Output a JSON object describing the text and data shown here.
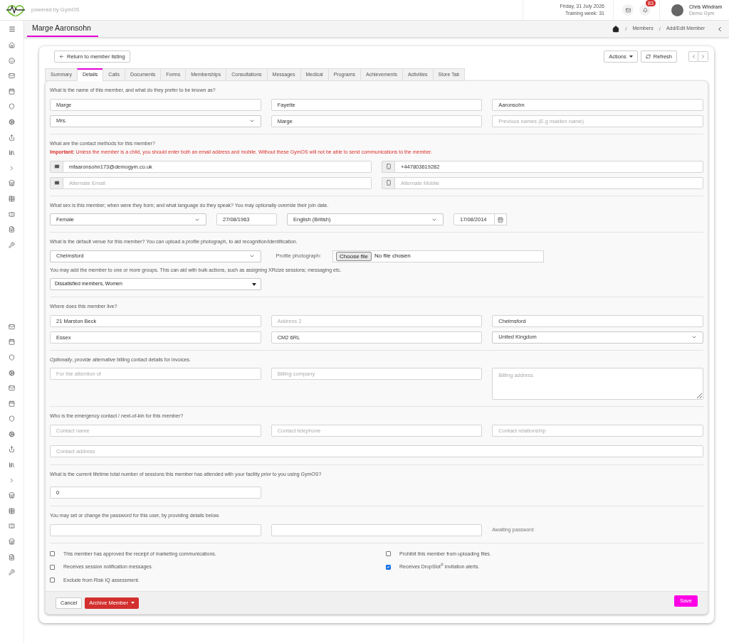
{
  "header": {
    "powered_by": "powered by GymOS",
    "date": "Friday, 31 July 2026",
    "training_week": "Training week: 31",
    "notification_count": "83",
    "user_name": "Chris Windram",
    "user_gym": "Demo Gym"
  },
  "page_title": "Marge Aaronsohn",
  "breadcrumb": [
    {
      "separator": "/",
      "label": "Members"
    },
    {
      "separator": "/",
      "label": "Add/Edit Member"
    }
  ],
  "back_button": "Return to member listing",
  "actions_button": "Actions",
  "refresh_button": "Refresh",
  "tabs": [
    {
      "label": "Summary",
      "selected": false
    },
    {
      "label": "Details",
      "selected": true
    },
    {
      "label": "Calls",
      "selected": false
    },
    {
      "label": "Documents",
      "selected": false
    },
    {
      "label": "Forms",
      "selected": false
    },
    {
      "label": "Memberships",
      "selected": false
    },
    {
      "label": "Consultations",
      "selected": false
    },
    {
      "label": "Messages",
      "selected": false
    },
    {
      "label": "Medical",
      "selected": false
    },
    {
      "label": "Programs",
      "selected": false
    },
    {
      "label": "Achievements",
      "selected": false
    },
    {
      "label": "Activities",
      "selected": false
    },
    {
      "label": "Store Tab",
      "selected": false
    }
  ],
  "sections": [
    {
      "blocks": [
        {
          "kind": "question",
          "text": "What is the name of this member, and what do they prefer to be known as?"
        },
        {
          "kind": "row",
          "fields": [
            {
              "kind": "text",
              "value": "Marge"
            },
            {
              "kind": "text",
              "value": "Fayette"
            },
            {
              "kind": "text",
              "value": "Aaronsohn"
            }
          ]
        },
        {
          "kind": "row",
          "fields": [
            {
              "kind": "select",
              "value": "Mrs."
            },
            {
              "kind": "text",
              "value": "Marge"
            },
            {
              "kind": "text",
              "placeholder": "Previous names (E.g maiden name)"
            }
          ]
        }
      ]
    },
    {
      "blocks": [
        {
          "kind": "question",
          "text": "What are the contact methods for this member?"
        },
        {
          "kind": "warning",
          "text": "**Important:** Unless the member is a child, you should enter both an email address and mobile. Without these GymOS will not be able to send communications to the member."
        },
        {
          "kind": "row",
          "fields": [
            {
              "kind": "email",
              "value": "mfaaronsohn173@demogym.co.uk"
            },
            {
              "kind": "phone",
              "value": "+447803619282"
            }
          ]
        },
        {
          "kind": "row",
          "fields": [
            {
              "kind": "email",
              "placeholder": "Alternate Email"
            },
            {
              "kind": "phone",
              "placeholder": "Alternate Mobile"
            }
          ]
        }
      ]
    },
    {
      "blocks": [
        {
          "kind": "question",
          "text": "What sex is this member; when were they born; and what language do they speak? You may optionally override their join date."
        },
        {
          "kind": "row",
          "fields": [
            {
              "kind": "select",
              "value": "Female"
            },
            {
              "kind": "text",
              "value": "27/08/1963"
            },
            {
              "kind": "select",
              "value": "English (British)"
            },
            {
              "kind": "date",
              "value": "17/08/2014"
            }
          ]
        }
      ]
    },
    {
      "blocks": [
        {
          "kind": "question",
          "text": "What is the default venue for this member? You can upload a profile photograph, to aid recognition/identification."
        },
        {
          "kind": "row",
          "fields": [
            {
              "kind": "select",
              "value": "Chelmsford"
            },
            {
              "kind": "file",
              "label": "Profile photograph:",
              "button": "Choose file",
              "status": "No file chosen"
            }
          ]
        },
        {
          "kind": "question",
          "text": "You may add the member to one or more groups. This can aid with bulk actions, such as assigning XRcize sessions; messaging etc."
        },
        {
          "kind": "row",
          "fields": [
            {
              "kind": "multiselect",
              "value": "Dissatisfied members, Women"
            }
          ]
        }
      ]
    },
    {
      "blocks": [
        {
          "kind": "question",
          "text": "Where does this member live?"
        },
        {
          "kind": "row",
          "fields": [
            {
              "kind": "text",
              "value": "21 Marston Beck"
            },
            {
              "kind": "text",
              "placeholder": "Address 2"
            },
            {
              "kind": "text",
              "value": "Chelmsford"
            }
          ]
        },
        {
          "kind": "row",
          "fields": [
            {
              "kind": "text",
              "value": "Essex"
            },
            {
              "kind": "text",
              "value": "CM2 6RL"
            },
            {
              "kind": "select",
              "value": "United Kingdom"
            }
          ]
        }
      ]
    },
    {
      "blocks": [
        {
          "kind": "question",
          "text": "*Optionally*, provide alternative billing contact details for invoices."
        },
        {
          "kind": "row",
          "fields": [
            {
              "kind": "text",
              "placeholder": "For the attention of"
            },
            {
              "kind": "text",
              "placeholder": "Billing company"
            },
            {
              "kind": "textarea",
              "placeholder": "Billing address"
            }
          ]
        }
      ]
    },
    {
      "blocks": [
        {
          "kind": "question",
          "text": "Who is the emergency contact / next-of-kin for this member?"
        },
        {
          "kind": "row",
          "fields": [
            {
              "kind": "text",
              "placeholder": "Contact name"
            },
            {
              "kind": "text",
              "placeholder": "Contact telephone"
            },
            {
              "kind": "text",
              "placeholder": "Contact relationship"
            }
          ]
        },
        {
          "kind": "row",
          "fields": [
            {
              "kind": "wide",
              "placeholder": "Contact address"
            }
          ]
        }
      ]
    },
    {
      "blocks": [
        {
          "kind": "question",
          "text": "What is the current lifetime total number of sessions this member has attended with your facility *prior* to you using GymOS?"
        },
        {
          "kind": "row",
          "fields": [
            {
              "kind": "text",
              "value": "0"
            }
          ]
        }
      ]
    },
    {
      "blocks": [
        {
          "kind": "question",
          "text": "You may set or change the password for this user, by providing details below."
        },
        {
          "kind": "row",
          "fields": [
            {
              "kind": "password"
            },
            {
              "kind": "password"
            },
            {
              "kind": "status",
              "text": "Awaiting password"
            }
          ]
        }
      ]
    }
  ],
  "checkboxes": {
    "left": [
      {
        "label": "This member has approved the receipt of marketing communications.",
        "checked": false
      },
      {
        "label": "Receives session notification messages.",
        "checked": false
      },
      {
        "label": "Exclude from Risk IQ assessment.",
        "checked": false
      }
    ],
    "right": [
      {
        "label": "Prohibit this member from uploading files.",
        "checked": false
      },
      {
        "label": "Receives DropSlot$^{®}$ invitation alerts.",
        "checked": true
      }
    ]
  },
  "cancel_button": "Cancel",
  "archive_button": "Archive Member",
  "save_button": "Save"
}
